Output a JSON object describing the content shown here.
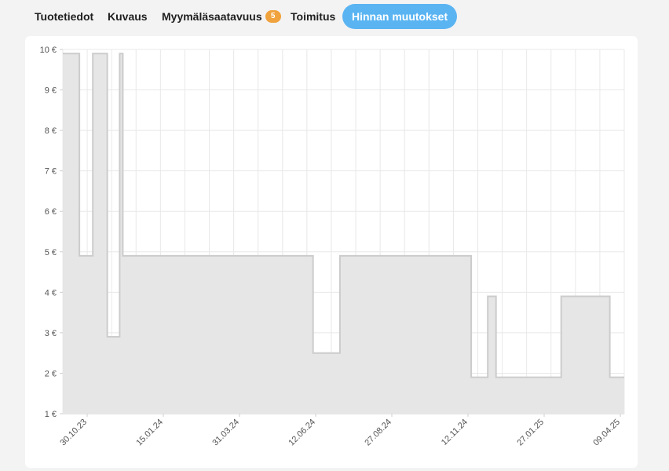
{
  "tabs": [
    {
      "label": "Tuotetiedot"
    },
    {
      "label": "Kuvaus"
    },
    {
      "label": "Myymäläsaatavuus",
      "badge": "5"
    },
    {
      "label": "Toimitus"
    },
    {
      "label": "Hinnan muutokset",
      "active": true
    }
  ],
  "colors": {
    "active_tab": "#5ab4f2",
    "badge": "#f0a23c",
    "area_fill": "#e6e6e6",
    "area_line": "#cccccc",
    "grid": "#e8e8e8"
  },
  "chart_data": {
    "type": "area",
    "step": true,
    "x": [
      "2023-10-14",
      "2023-10-30",
      "2023-11-12",
      "2023-11-26",
      "2023-12-08",
      "2023-12-11",
      "2024-05-05",
      "2024-06-12",
      "2024-07-08",
      "2024-10-07",
      "2024-11-12",
      "2024-11-28",
      "2024-12-06",
      "2024-12-29",
      "2025-02-07",
      "2025-03-26",
      "2025-04-09"
    ],
    "values": [
      9.9,
      4.9,
      9.9,
      2.9,
      9.9,
      4.9,
      4.9,
      2.5,
      4.9,
      4.9,
      1.9,
      3.9,
      1.9,
      1.9,
      3.9,
      1.9,
      1.9
    ],
    "ylim": [
      1,
      10
    ],
    "xlim": [
      "2023-10-14",
      "2025-04-09"
    ],
    "yticks": [
      1,
      2,
      3,
      4,
      5,
      6,
      7,
      8,
      9,
      10
    ],
    "ytick_labels": [
      "1 €",
      "2 €",
      "3 €",
      "4 €",
      "5 €",
      "6 €",
      "7 €",
      "8 €",
      "9 €",
      "10 €"
    ],
    "xtick_labels": [
      "30.10.23",
      "15.01.24",
      "31.03.24",
      "12.06.24",
      "27.08.24",
      "12.11.24",
      "27.01.25",
      "09.04.25"
    ],
    "grid": true,
    "title": "",
    "xlabel": "",
    "ylabel": ""
  }
}
